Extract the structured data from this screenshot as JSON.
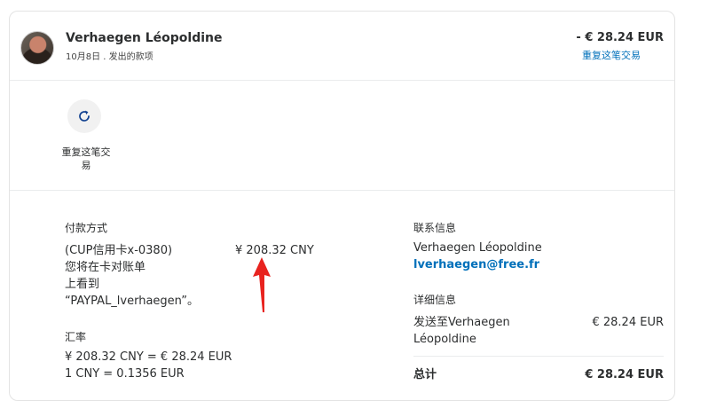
{
  "header": {
    "name": "Verhaegen Léopoldine",
    "date_line": "10月8日 . 发出的款项",
    "amount": "- € 28.24 EUR",
    "repeat_link": "重复这笔交易"
  },
  "repeat_button": {
    "label": "重复这笔交易",
    "icon": "refresh-icon"
  },
  "payment": {
    "title": "付款方式",
    "method_line1": "(CUP信用卡x-0380)",
    "method_line2": "您将在卡对账单",
    "method_line3": "上看到",
    "method_line4": "“PAYPAL_lverhaegen”。",
    "amount": "¥ 208.32 CNY"
  },
  "exchange": {
    "title": "汇率",
    "line1": "¥ 208.32 CNY = € 28.24 EUR",
    "line2": "1 CNY = 0.1356 EUR"
  },
  "contact": {
    "title": "联系信息",
    "name": "Verhaegen Léopoldine",
    "email": "lverhaegen@free.fr"
  },
  "details": {
    "title": "详细信息",
    "sent_to_line1": "发送至Verhaegen",
    "sent_to_line2": "Léopoldine",
    "sent_amount": "€ 28.24 EUR",
    "total_label": "总计",
    "total_amount": "€ 28.24 EUR"
  },
  "colors": {
    "accent": "#0070ba",
    "annotation_arrow": "#e8231f"
  }
}
